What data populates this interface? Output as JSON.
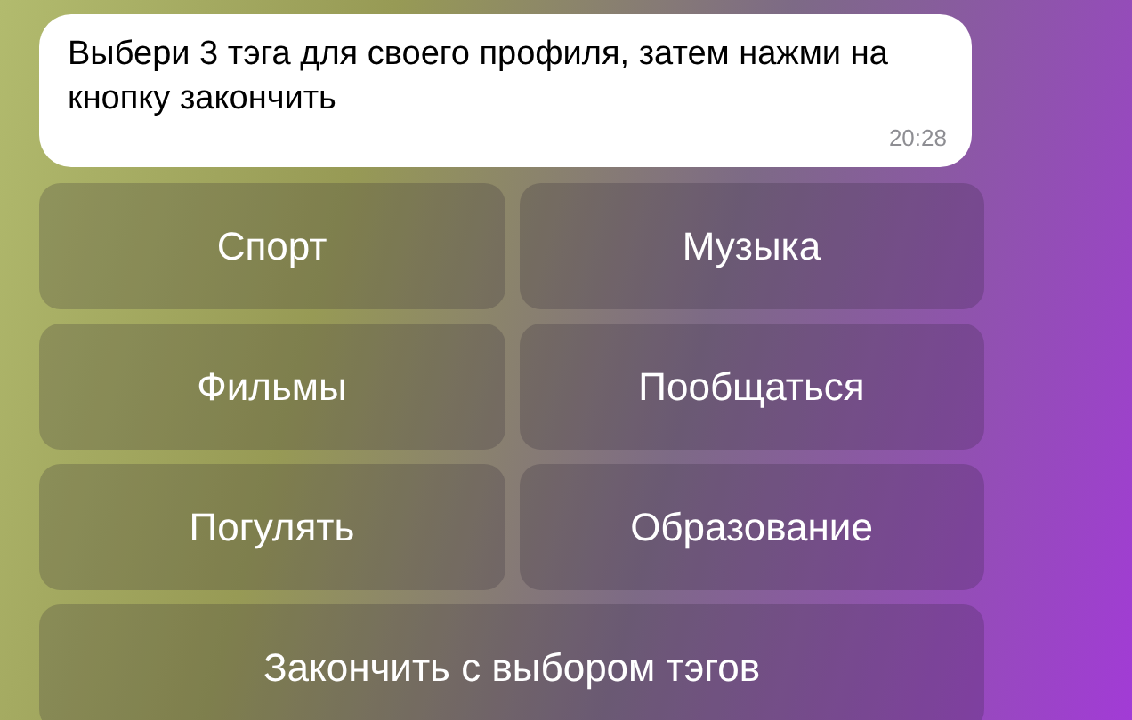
{
  "message": {
    "text": "Выбери 3 тэга для своего профиля, затем нажми на кнопку закончить",
    "time": "20:28"
  },
  "keyboard": [
    [
      "Спорт",
      "Музыка"
    ],
    [
      "Фильмы",
      "Пообщаться"
    ],
    [
      "Погулять",
      "Образование"
    ],
    [
      "Закончить с выбором тэгов"
    ]
  ]
}
